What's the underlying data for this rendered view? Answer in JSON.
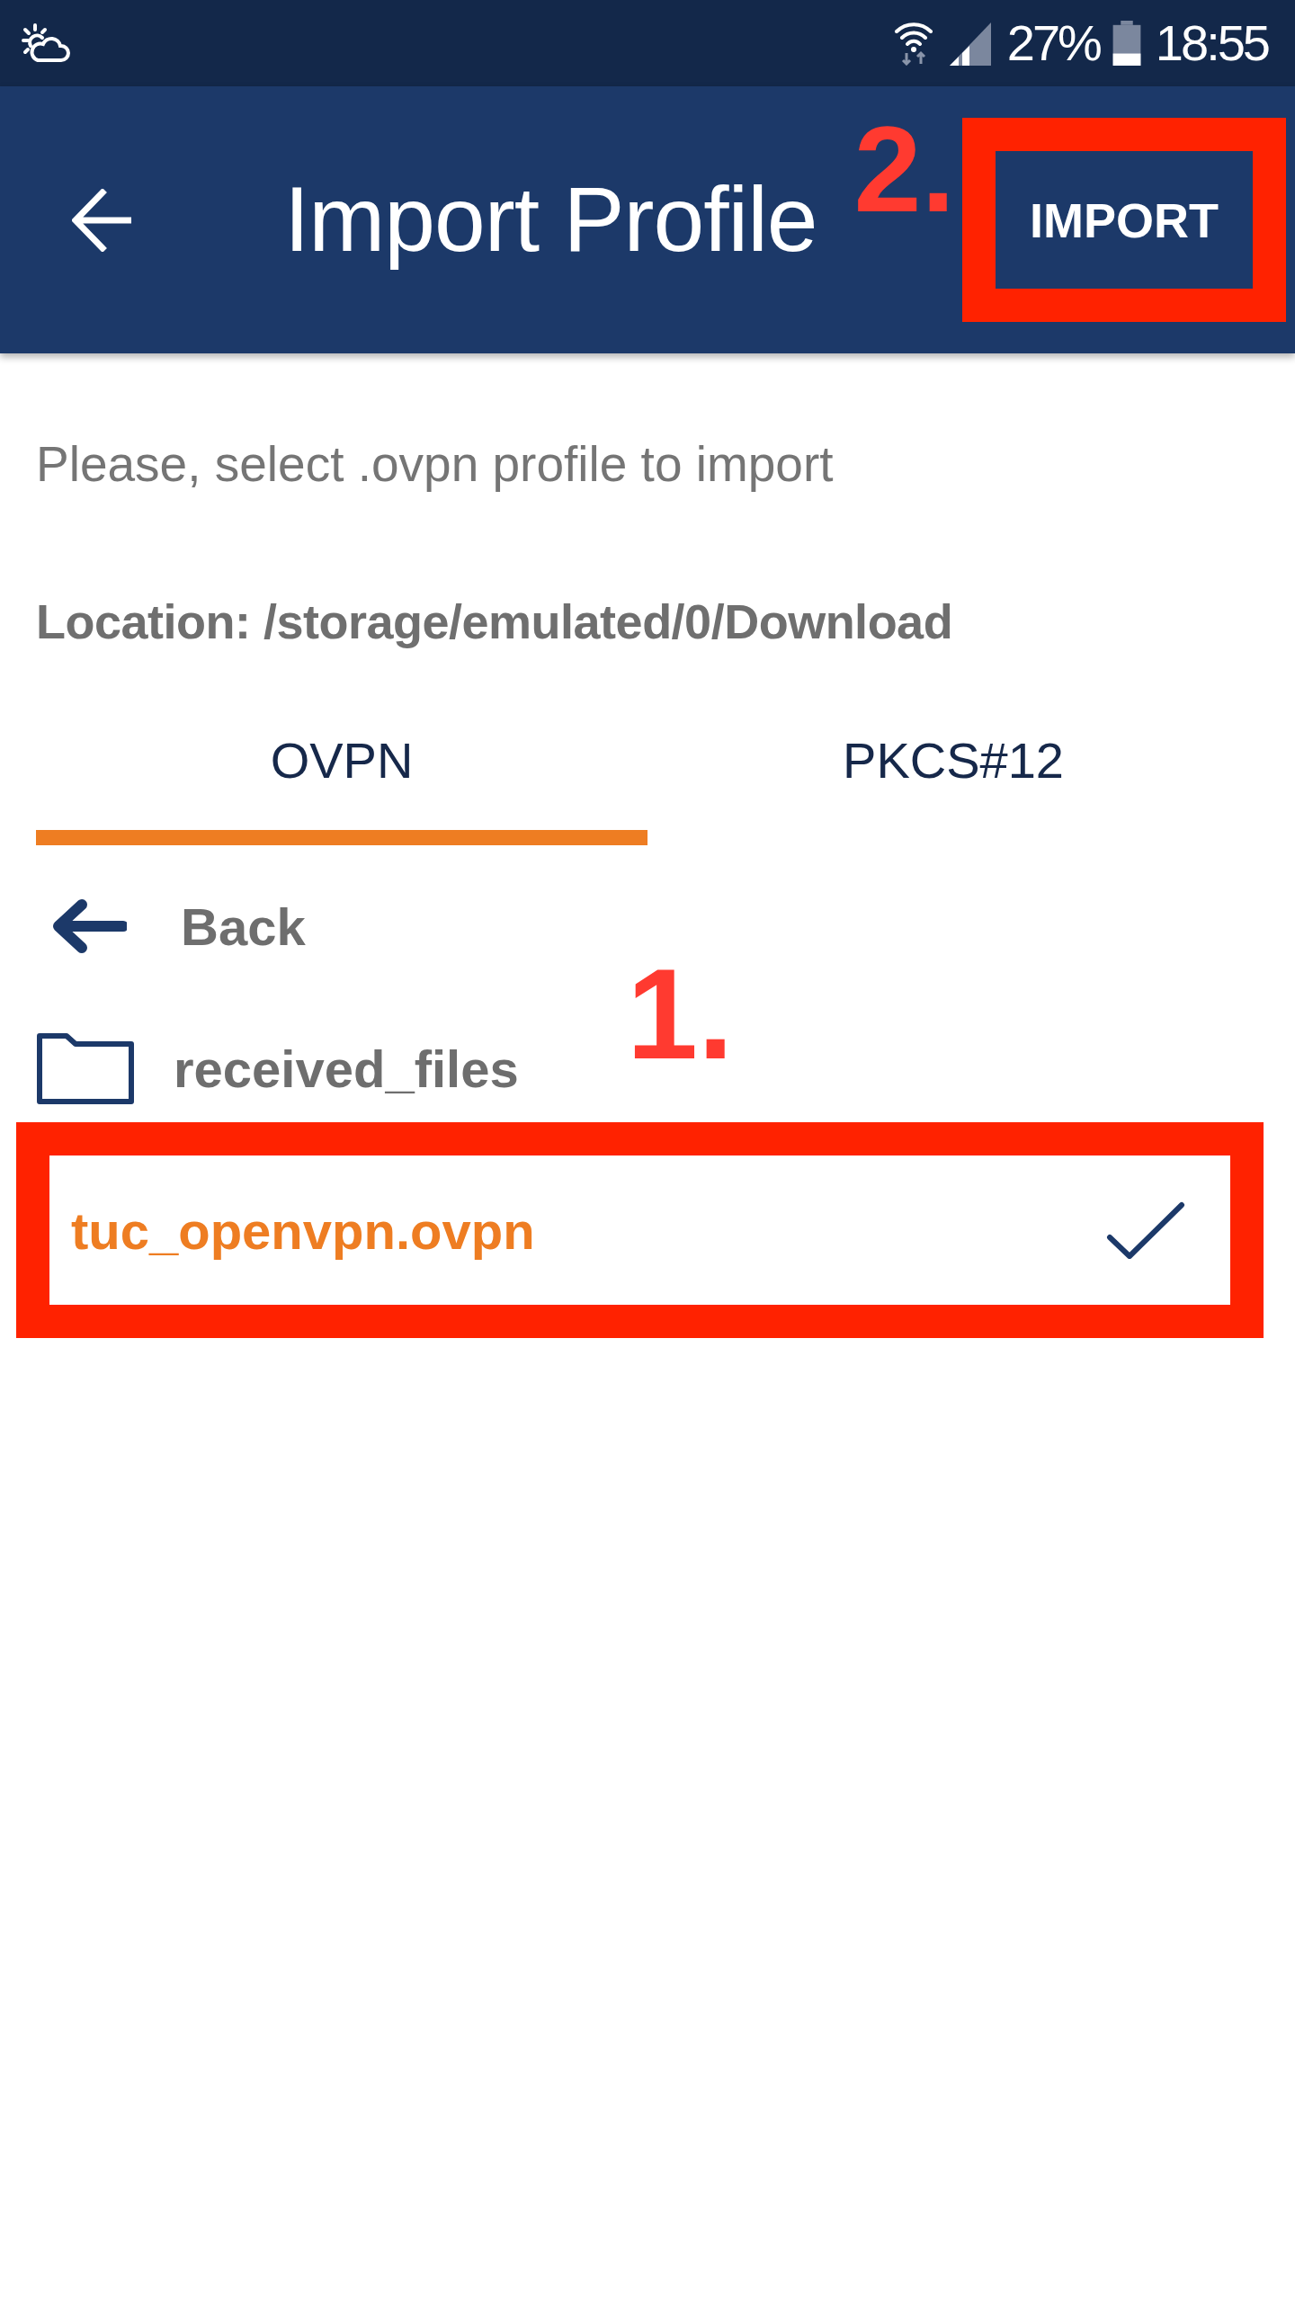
{
  "status_bar": {
    "battery": "27%",
    "time": "18:55"
  },
  "header": {
    "title": "Import Profile",
    "action": {
      "label": "IMPORT",
      "highlighted": true,
      "step": "2."
    }
  },
  "instruction": "Please, select .ovpn profile to import",
  "location": "Location: /storage/emulated/0/Download",
  "tabs": [
    {
      "label": "OVPN",
      "selected": true
    },
    {
      "label": "PKCS#12",
      "selected": false
    }
  ],
  "files": [
    {
      "kind": "back",
      "label": "Back",
      "selected": false,
      "highlighted": false
    },
    {
      "kind": "folder",
      "label": "received_files",
      "selected": false,
      "highlighted": false
    },
    {
      "kind": "file",
      "label": "tuc_openvpn.ovpn",
      "selected": true,
      "highlighted": true,
      "step": "1."
    }
  ]
}
